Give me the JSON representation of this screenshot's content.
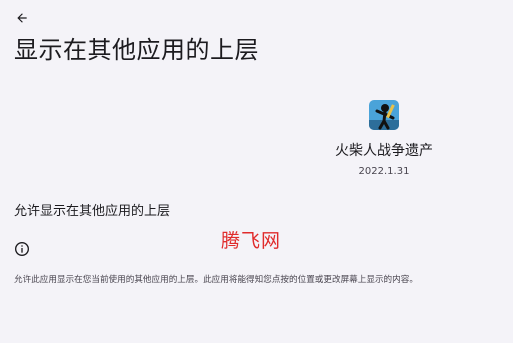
{
  "header": {
    "back_icon": "arrow-back-icon",
    "title": "显示在其他应用的上层"
  },
  "app": {
    "icon": "stickman-app-icon",
    "name": "火柴人战争遗产",
    "version": "2022.1.31"
  },
  "setting": {
    "label": "允许显示在其他应用的上层",
    "enabled": false
  },
  "info": {
    "icon": "info-icon",
    "description": "允许此应用显示在您当前使用的其他应用的上层。此应用将能得知您点按的位置或更改屏幕上显示的内容。"
  },
  "watermark": {
    "text": "腾飞网"
  },
  "colors": {
    "background": "#f4f3f8",
    "text_primary": "#1c1b1f",
    "text_secondary": "#49454f",
    "watermark": "#e02b2b"
  }
}
